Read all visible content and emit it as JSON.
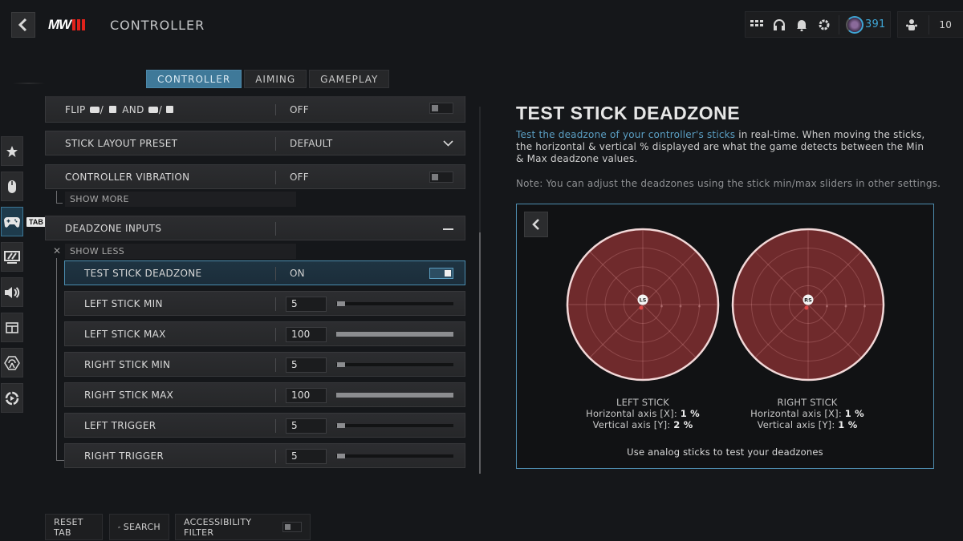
{
  "header": {
    "title": "CONTROLLER",
    "logo_text": "MW",
    "level": "391",
    "party_count": "10",
    "icons": [
      "grid-menu-icon",
      "headset-icon",
      "bell-icon",
      "gear-icon"
    ]
  },
  "tabs": [
    {
      "label": "CONTROLLER",
      "active": true
    },
    {
      "label": "AIMING",
      "active": false
    },
    {
      "label": "GAMEPLAY",
      "active": false
    }
  ],
  "side_nav": {
    "items": [
      {
        "icon": "star-icon"
      },
      {
        "icon": "mouse-icon"
      },
      {
        "icon": "gamepad-icon",
        "active": true
      },
      {
        "icon": "display-icon"
      },
      {
        "icon": "speaker-icon"
      },
      {
        "icon": "interface-icon"
      },
      {
        "icon": "network-icon"
      },
      {
        "icon": "replay-icon"
      }
    ],
    "tab_hint": "TAB"
  },
  "settings": {
    "flip": {
      "label_prefix": "FLIP",
      "label_and": "AND",
      "value": "OFF"
    },
    "stick_layout": {
      "label": "STICK LAYOUT PRESET",
      "value": "DEFAULT"
    },
    "vibration": {
      "label": "CONTROLLER VIBRATION",
      "value": "OFF"
    },
    "show_more": "SHOW MORE",
    "deadzone_inputs": {
      "label": "DEADZONE INPUTS"
    },
    "show_less": "SHOW LESS",
    "test_stick": {
      "label": "TEST STICK DEADZONE",
      "value": "ON"
    },
    "sliders": [
      {
        "label": "LEFT STICK MIN",
        "value": "5",
        "fraction": 0.05
      },
      {
        "label": "LEFT STICK MAX",
        "value": "100",
        "fraction": 1.0
      },
      {
        "label": "RIGHT STICK MIN",
        "value": "5",
        "fraction": 0.05
      },
      {
        "label": "RIGHT STICK MAX",
        "value": "100",
        "fraction": 1.0
      },
      {
        "label": "LEFT TRIGGER",
        "value": "5",
        "fraction": 0.05
      },
      {
        "label": "RIGHT TRIGGER",
        "value": "5",
        "fraction": 0.05
      }
    ]
  },
  "detail": {
    "title": "TEST STICK DEADZONE",
    "desc_highlight": "Test the deadzone of your controller's sticks",
    "desc_rest": " in real-time. When moving the sticks, the horizontal & vertical % displayed are what the game detects between the Min & Max deadzone values.",
    "note": "Note: You can adjust the deadzones using the stick min/max sliders in other settings.",
    "left_stick": {
      "name": "LEFT STICK",
      "badge": "LS",
      "h_label": "Horizontal axis [X]: ",
      "h_value": "1 %",
      "v_label": "Vertical axis [Y]: ",
      "v_value": "2 %"
    },
    "right_stick": {
      "name": "RIGHT STICK",
      "badge": "RS",
      "h_label": "Horizontal axis [X]: ",
      "h_value": "1 %",
      "v_label": "Vertical axis [Y]: ",
      "v_value": "1 %"
    },
    "hint": "Use analog sticks to test your deadzones",
    "colors": {
      "zone_fill": "#6f2a2c",
      "zone_ring": "#f2d8d8",
      "accent": "#4e8db0"
    }
  },
  "footer": {
    "reset": "RESET TAB",
    "search": "SEARCH",
    "accessibility": "ACCESSIBILITY FILTER"
  }
}
